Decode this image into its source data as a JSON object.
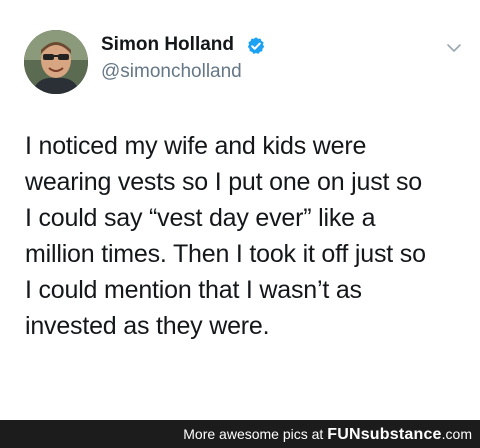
{
  "tweet": {
    "author": {
      "name": "Simon Holland",
      "handle": "@simoncholland",
      "verified": true
    },
    "text_lines": [
      "I noticed my wife and kids were",
      "wearing vests so I put one on just so",
      "I could say “vest day ever” like a",
      "million times. Then I took it off just so",
      "I could mention that I wasn’t as",
      "invested as they were."
    ],
    "icons": {
      "verified": "verified-badge-icon",
      "menu": "chevron-down-icon"
    },
    "colors": {
      "verified_blue": "#1da1f2",
      "handle_gray": "#657786",
      "text": "#14171a"
    }
  },
  "footer": {
    "prefix": "More awesome pics at ",
    "brand": "FUNsubstance",
    "suffix": ".com"
  }
}
